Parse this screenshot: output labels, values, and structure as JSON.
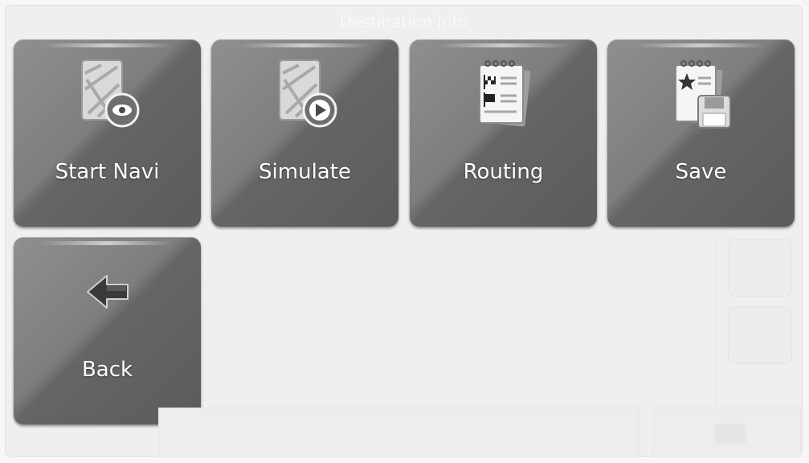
{
  "screen": {
    "title": "Destination Info"
  },
  "menu": {
    "items": [
      {
        "id": "start_navi",
        "label": "Start Navi",
        "icon": "map-eye-icon"
      },
      {
        "id": "simulate",
        "label": "Simulate",
        "icon": "map-play-icon"
      },
      {
        "id": "routing",
        "label": "Routing",
        "icon": "route-list-icon"
      },
      {
        "id": "save",
        "label": "Save",
        "icon": "save-favorite-icon"
      }
    ],
    "back": {
      "label": "Back",
      "icon": "back-arrow-icon"
    }
  },
  "colors": {
    "tile": "#777777",
    "tile_text": "#ffffff",
    "background": "#efefef"
  }
}
